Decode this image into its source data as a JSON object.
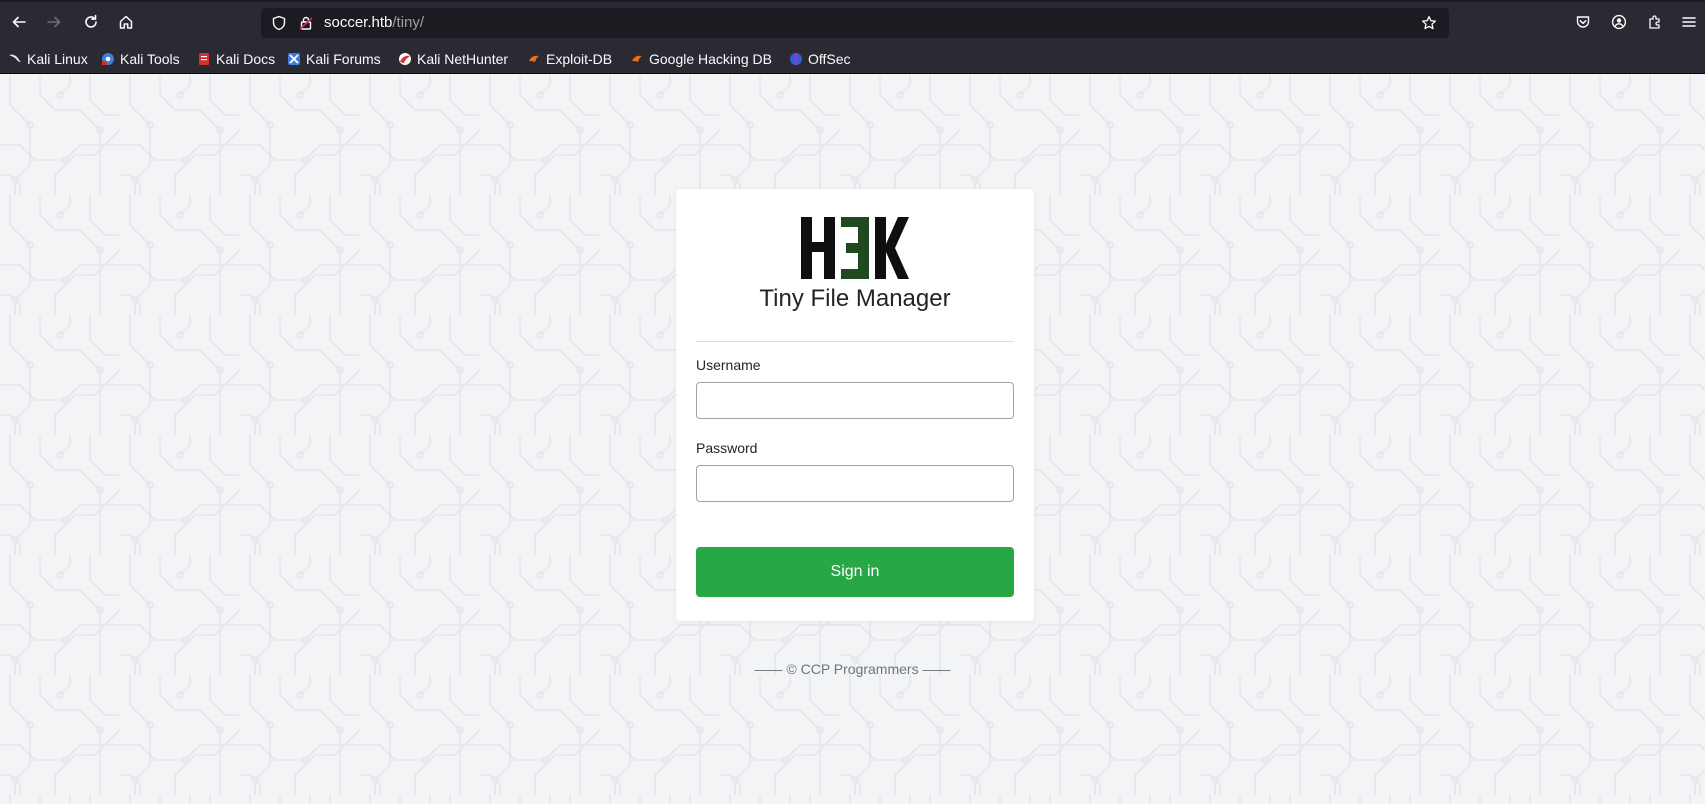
{
  "browser": {
    "url_host": "soccer.htb",
    "url_path": "/tiny/",
    "bookmarks": [
      {
        "label": "Kali Linux",
        "icon": "kali-dragon-icon"
      },
      {
        "label": "Kali Tools",
        "icon": "kali-tools-icon"
      },
      {
        "label": "Kali Docs",
        "icon": "kali-docs-icon"
      },
      {
        "label": "Kali Forums",
        "icon": "kali-forums-icon"
      },
      {
        "label": "Kali NetHunter",
        "icon": "kali-nethunter-icon"
      },
      {
        "label": "Exploit-DB",
        "icon": "exploit-db-icon"
      },
      {
        "label": "Google Hacking DB",
        "icon": "google-hacking-db-icon"
      },
      {
        "label": "OffSec",
        "icon": "offsec-icon"
      }
    ]
  },
  "login": {
    "logo_text": "H3K",
    "title": "Tiny File Manager",
    "username_label": "Username",
    "username_value": "",
    "password_label": "Password",
    "password_value": "",
    "submit_label": "Sign in"
  },
  "footer": {
    "text": "—— © CCP Programmers ——"
  },
  "colors": {
    "chrome_bg": "#2b2a33",
    "urlbar_bg": "#1c1b22",
    "page_bg": "#f3f4f6",
    "button_bg": "#28a745",
    "logo_accent": "#1f4a1f"
  }
}
